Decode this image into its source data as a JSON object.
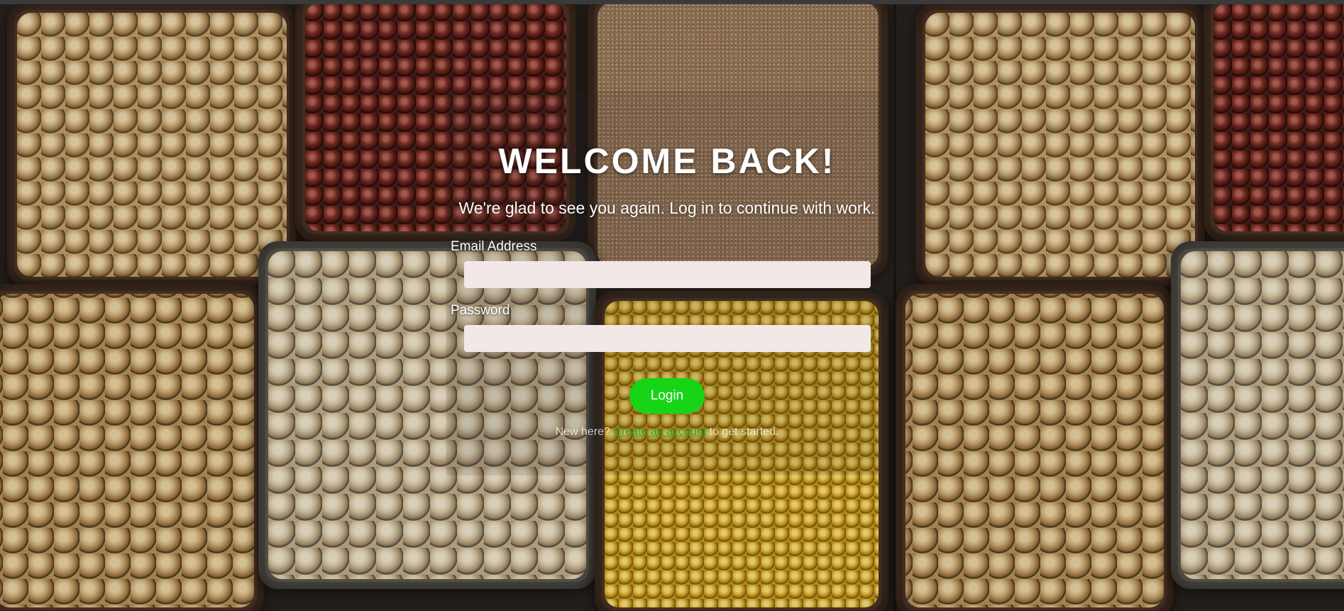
{
  "login": {
    "title": "WELCOME BACK!",
    "subtitle": "We're glad to see you again. Log in to continue with work.",
    "email_label": "Email Address",
    "email_value": "",
    "password_label": "Password",
    "password_value": "",
    "submit_label": "Login",
    "signup_prefix": "New here? ",
    "signup_link": "Create an account",
    "signup_suffix": " to get started."
  },
  "colors": {
    "button": "#17d417",
    "link": "#1fa81f",
    "field_background": "#f2e8e8",
    "text": "#ffffff"
  }
}
